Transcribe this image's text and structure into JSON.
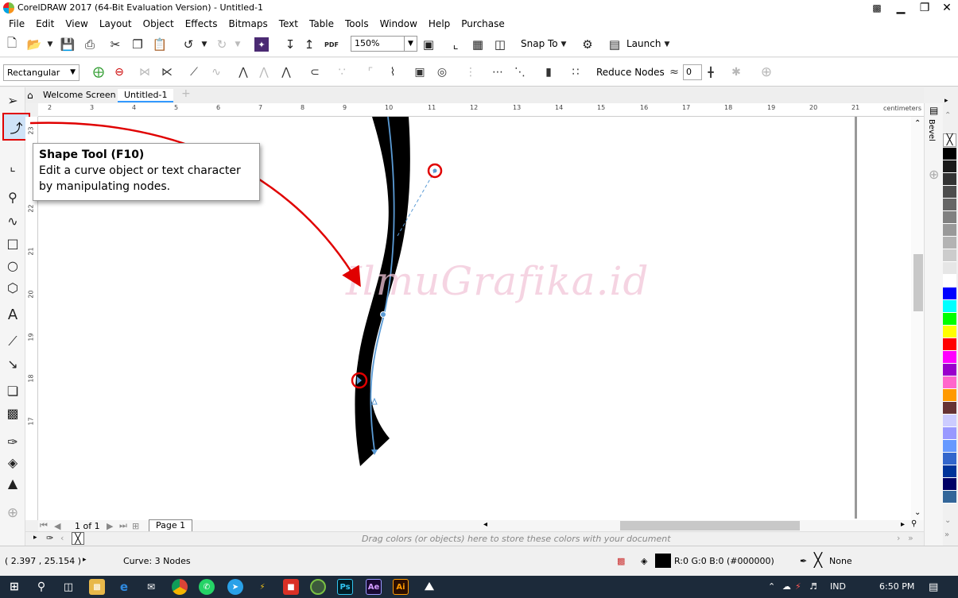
{
  "window": {
    "title": "CorelDRAW 2017 (64-Bit Evaluation Version) - Untitled-1",
    "controls": [
      "▁",
      "❐",
      "✕"
    ]
  },
  "menu": [
    "File",
    "Edit",
    "View",
    "Layout",
    "Object",
    "Effects",
    "Bitmaps",
    "Text",
    "Table",
    "Tools",
    "Window",
    "Help",
    "Purchase"
  ],
  "standard_toolbar": {
    "zoom": "150%",
    "snap_to": "Snap To",
    "launch": "Launch"
  },
  "property_bar": {
    "selection_mode": "Rectangular",
    "reduce_nodes": "Reduce Nodes",
    "curve_smoothness": "0"
  },
  "tabs": [
    {
      "label": "Welcome Screen",
      "active": false
    },
    {
      "label": "Untitled-1",
      "active": true
    }
  ],
  "ruler": {
    "h_numbers": [
      "2",
      "3",
      "4",
      "5",
      "6",
      "7",
      "8",
      "9",
      "10",
      "11",
      "12",
      "13",
      "14",
      "15",
      "16",
      "17",
      "18",
      "19",
      "20",
      "21"
    ],
    "unit": "centimeters",
    "v_numbers": [
      "23",
      "22",
      "21",
      "20",
      "19",
      "18",
      "17"
    ]
  },
  "tooltip": {
    "title": "Shape Tool (F10)",
    "description": "Edit a curve object or text character by manipulating nodes."
  },
  "watermark": "IlmuGrafika.id",
  "page_nav": {
    "position": "1 of 1",
    "page_tab": "Page 1"
  },
  "color_tray_hint": "Drag colors (or objects) here to store these colors with your document",
  "docker": {
    "label": "Bevel"
  },
  "palette": [
    "#000000",
    "#1a1a1a",
    "#333333",
    "#4d4d4d",
    "#666666",
    "#808080",
    "#999999",
    "#b3b3b3",
    "#cccccc",
    "#e6e6e6",
    "#ffffff",
    "#0000ff",
    "#00ffff",
    "#00ff00",
    "#ffff00",
    "#ff0000",
    "#ff00ff",
    "#9900cc",
    "#ff66cc",
    "#ff9900",
    "#663333",
    "#ccccff",
    "#9999ff",
    "#6699ff",
    "#3366cc",
    "#003399",
    "#000066",
    "#336699"
  ],
  "status": {
    "coords": "( 2.397 , 25.154 )",
    "object_info": "Curve: 3 Nodes",
    "fill_color": "R:0 G:0 B:0 (#000000)",
    "outline": "None"
  },
  "taskbar": {
    "language": "IND",
    "time": "6:50 PM"
  },
  "colors": {
    "highlight_red": "#e00000",
    "curve_blue": "#5b9bd5",
    "accent_blue": "#3399ff"
  }
}
